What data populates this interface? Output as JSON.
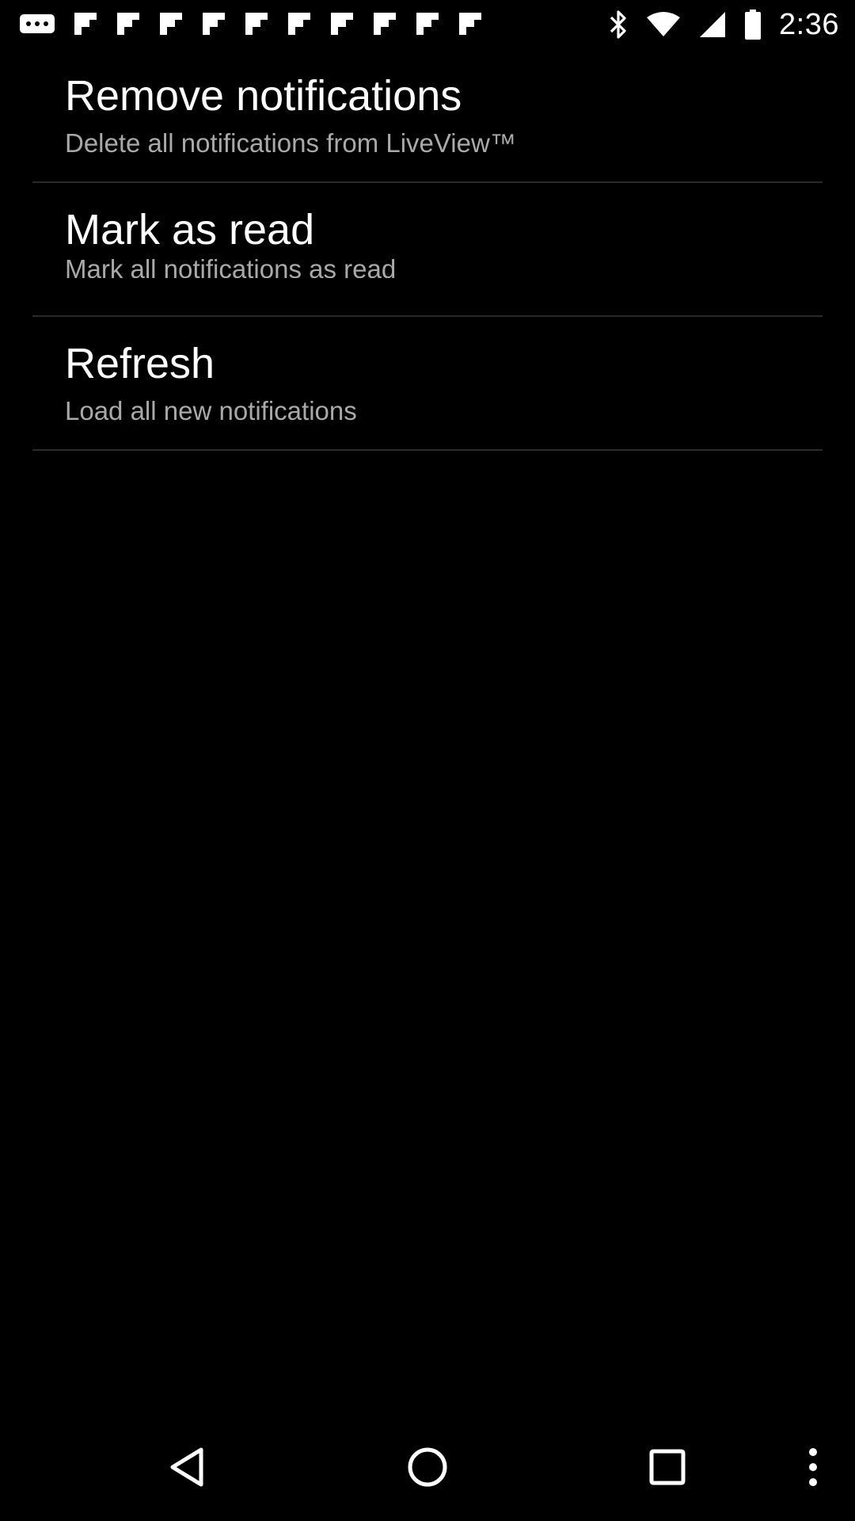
{
  "status_bar": {
    "time": "2:36",
    "left_icons": [
      "more-notifications-icon",
      "flipboard-icon",
      "flipboard-icon",
      "flipboard-icon",
      "flipboard-icon",
      "flipboard-icon",
      "flipboard-icon",
      "flipboard-icon",
      "flipboard-icon",
      "flipboard-icon",
      "flipboard-icon"
    ],
    "right_icons": [
      "bluetooth-icon",
      "wifi-icon",
      "cell-signal-icon",
      "battery-icon"
    ]
  },
  "menu": {
    "items": [
      {
        "title": "Remove notifications",
        "subtitle": "Delete all notifications from LiveView™"
      },
      {
        "title": "Mark as read",
        "subtitle": "Mark all notifications as read"
      },
      {
        "title": "Refresh",
        "subtitle": "Load all new notifications"
      }
    ]
  },
  "nav_bar": {
    "buttons": [
      "back-icon",
      "home-icon",
      "recents-icon",
      "overflow-menu-icon"
    ]
  },
  "colors": {
    "background": "#000000",
    "title_text": "#ffffff",
    "subtitle_text": "#a9a9a9",
    "divider": "#2a2a2a"
  }
}
